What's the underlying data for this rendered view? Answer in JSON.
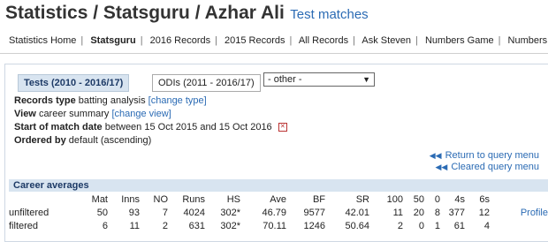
{
  "header": {
    "title": "Statistics / Statsguru / Azhar Ali",
    "subtitle": "Test matches"
  },
  "nav": {
    "items": [
      {
        "label": "Statistics Home"
      },
      {
        "label": "Statsguru"
      },
      {
        "label": "2016 Records"
      },
      {
        "label": "2015 Records"
      },
      {
        "label": "All Records"
      },
      {
        "label": "Ask Steven"
      },
      {
        "label": "Numbers Game"
      },
      {
        "label": "Numbers Don't"
      }
    ]
  },
  "tabs": {
    "tests": "Tests (2010 - 2016/17)",
    "odis": "ODIs (2011 - 2016/17)"
  },
  "other_select": {
    "value": "- other -"
  },
  "query": {
    "records_type_label": "Records type",
    "records_type_value": "batting analysis",
    "change_type": "[change type]",
    "view_label": "View",
    "view_value": "career summary",
    "change_view": "[change view]",
    "start_label": "Start of match date",
    "start_value": "between 15 Oct 2015 and 15 Oct 2016",
    "ordered_label": "Ordered by",
    "ordered_value": "default (ascending)"
  },
  "links": {
    "return": "Return to query menu",
    "cleared": "Cleared query menu"
  },
  "career": {
    "heading": "Career averages",
    "columns": [
      "",
      "Mat",
      "Inns",
      "NO",
      "Runs",
      "HS",
      "Ave",
      "BF",
      "SR",
      "100",
      "50",
      "0",
      "4s",
      "6s",
      ""
    ],
    "rows": [
      {
        "label": "unfiltered",
        "cells": [
          "50",
          "93",
          "7",
          "4024",
          "302*",
          "46.79",
          "9577",
          "42.01",
          "11",
          "20",
          "8",
          "377",
          "12"
        ],
        "link": "Profile"
      },
      {
        "label": "filtered",
        "cells": [
          "6",
          "11",
          "2",
          "631",
          "302*",
          "70.11",
          "1246",
          "50.64",
          "2",
          "0",
          "1",
          "61",
          "4"
        ],
        "link": ""
      }
    ]
  }
}
